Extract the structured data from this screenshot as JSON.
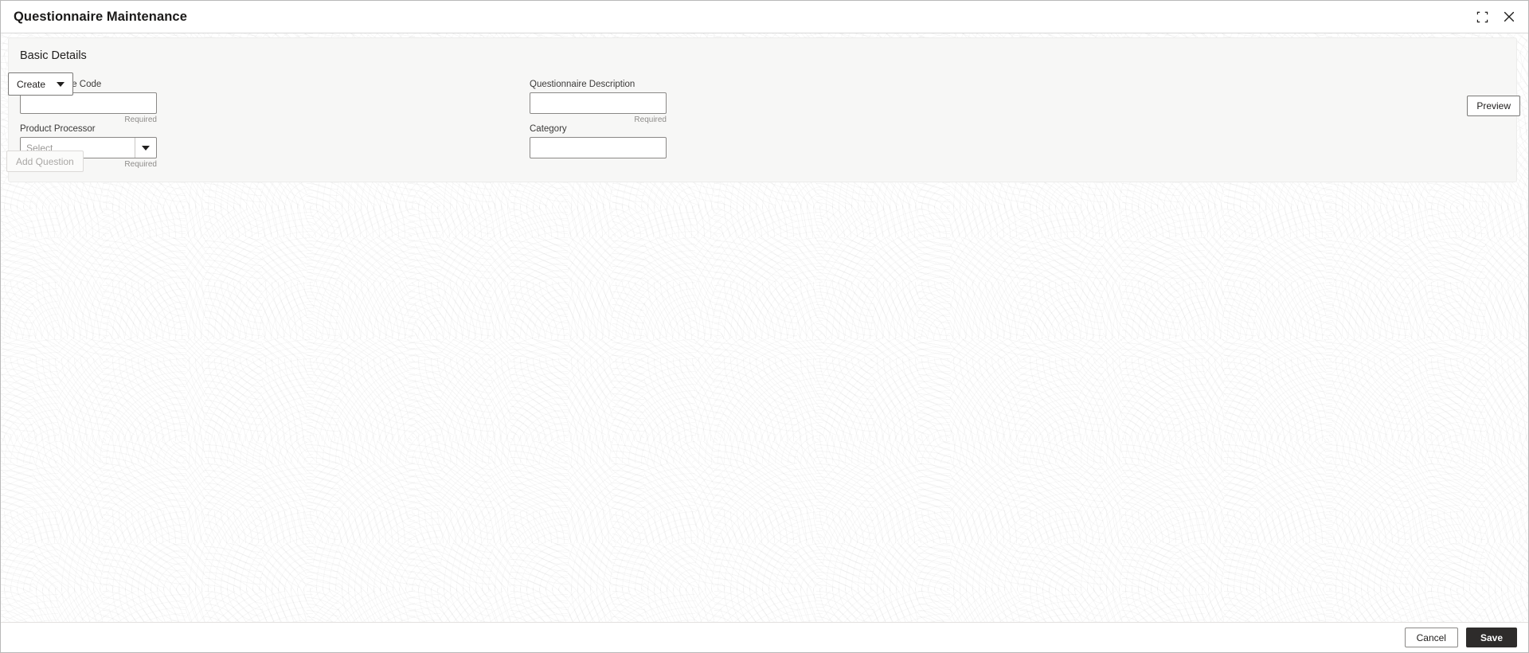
{
  "window": {
    "title": "Questionnaire Maintenance",
    "minimize_icon": "collapse-inward-icon",
    "close_icon": "close-icon"
  },
  "panel": {
    "heading": "Basic Details",
    "fields": {
      "questionnaire_code": {
        "label": "Questionnaire Code",
        "value": "",
        "placeholder": "",
        "helper": "Required"
      },
      "questionnaire_description": {
        "label": "Questionnaire Description",
        "value": "",
        "placeholder": "",
        "helper": "Required"
      },
      "product_processor": {
        "label": "Product Processor",
        "value": "Select",
        "helper": "Required",
        "caret_icon": "chevron-down-icon"
      },
      "category": {
        "label": "Category",
        "value": "",
        "placeholder": ""
      }
    }
  },
  "toolbar": {
    "create_label": "Create",
    "create_caret_icon": "chevron-down-icon",
    "preview_label": "Preview",
    "add_question_label": "Add Question",
    "add_question_disabled": true
  },
  "footer": {
    "cancel_label": "Cancel",
    "save_label": "Save"
  },
  "colors": {
    "panel_background": "#f7f7f6",
    "save_button": "#2e2c2b",
    "border": "#8a8886",
    "helper_text": "#8e8c8a"
  }
}
